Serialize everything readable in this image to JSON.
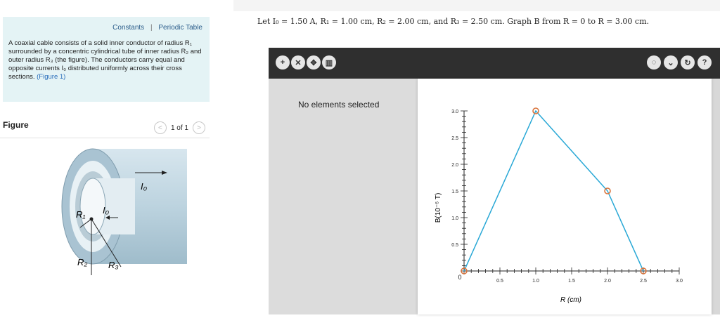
{
  "links": {
    "constants": "Constants",
    "separator": "|",
    "periodic": "Periodic Table"
  },
  "description": {
    "text": "A coaxial cable consists of a solid inner conductor of radius R₁ surrounded by a concentric cylindrical tube of inner radius R₂ and outer radius R₃ (the figure). The conductors carry equal and opposite currents I₀ distributed uniformly across their cross sections.",
    "link": "(Figure 1)"
  },
  "figure": {
    "title": "Figure",
    "pager": "1 of 1",
    "prev": "<",
    "next": ">",
    "labels": {
      "i0_top": "I₀",
      "i0_inner": "I₀",
      "r1": "R₁",
      "r2": "R₂",
      "r3": "R₃"
    }
  },
  "question": "Let I₀ = 1.50 A, R₁ = 1.00 cm, R₂ = 2.00 cm, and R₃ = 2.50 cm. Graph B from R = 0 to R = 3.00 cm.",
  "tools": {
    "left": [
      "add-icon",
      "cross-tool-icon",
      "move-tool-icon",
      "trash-icon"
    ],
    "right": [
      "hint-icon",
      "chevron-down-icon",
      "reset-icon",
      "help-icon"
    ]
  },
  "side_panel": {
    "status": "No elements selected"
  },
  "colors": {
    "line": "#29a8d6",
    "point": "#d9743c",
    "toolbar": "#2f2f2f"
  },
  "chart_data": {
    "type": "line",
    "xlabel": "R (cm)",
    "ylabel": "B(10⁻⁵ T)",
    "xlim": [
      0,
      3.0
    ],
    "ylim": [
      0,
      3.0
    ],
    "xticks": [
      "0",
      "0.5",
      "1.0",
      "1.5",
      "2.0",
      "2.5",
      "3.0"
    ],
    "yticks": [
      "0.5",
      "1.0",
      "1.5",
      "2.0",
      "2.5",
      "3.0"
    ],
    "x": [
      0,
      1.0,
      2.0,
      2.5
    ],
    "y": [
      0,
      3.0,
      1.5,
      0
    ]
  }
}
